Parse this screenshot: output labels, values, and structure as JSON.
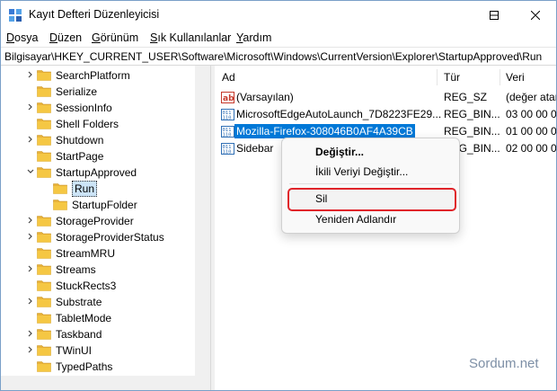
{
  "window": {
    "title": "Kayıt Defteri Düzenleyicisi",
    "controls": {
      "minimize": "minimize-icon",
      "maximize": "maximize-icon",
      "close": "close-icon"
    }
  },
  "menu": {
    "items": [
      {
        "u": "D",
        "rest": "osya"
      },
      {
        "u": "D",
        "rest": "üzen"
      },
      {
        "u": "G",
        "rest": "örünüm"
      },
      {
        "u": "S",
        "rest": "ık Kullanılanlar"
      },
      {
        "u": "Y",
        "rest": "ardım"
      }
    ]
  },
  "address": "Bilgisayar\\HKEY_CURRENT_USER\\Software\\Microsoft\\Windows\\CurrentVersion\\Explorer\\StartupApproved\\Run",
  "tree": {
    "items": [
      {
        "label": "SearchPlatform",
        "chevron": "right"
      },
      {
        "label": "Serialize",
        "chevron": "none"
      },
      {
        "label": "SessionInfo",
        "chevron": "right"
      },
      {
        "label": "Shell Folders",
        "chevron": "none"
      },
      {
        "label": "Shutdown",
        "chevron": "right"
      },
      {
        "label": "StartPage",
        "chevron": "none"
      },
      {
        "label": "StartupApproved",
        "chevron": "down"
      },
      {
        "label": "Run",
        "chevron": "none",
        "selected": true
      },
      {
        "label": "StartupFolder",
        "chevron": "none"
      },
      {
        "label": "StorageProvider",
        "chevron": "right"
      },
      {
        "label": "StorageProviderStatus",
        "chevron": "right"
      },
      {
        "label": "StreamMRU",
        "chevron": "none"
      },
      {
        "label": "Streams",
        "chevron": "right"
      },
      {
        "label": "StuckRects3",
        "chevron": "none"
      },
      {
        "label": "Substrate",
        "chevron": "right"
      },
      {
        "label": "TabletMode",
        "chevron": "none"
      },
      {
        "label": "Taskband",
        "chevron": "right"
      },
      {
        "label": "TWinUI",
        "chevron": "right"
      },
      {
        "label": "TypedPaths",
        "chevron": "none"
      }
    ]
  },
  "values": {
    "headers": {
      "name": "Ad",
      "type": "Tür",
      "data": "Veri"
    },
    "rows": [
      {
        "name": "(Varsayılan)",
        "type": "REG_SZ",
        "data": "(değer atan",
        "icon": "string-value-icon"
      },
      {
        "name": "MicrosoftEdgeAutoLaunch_7D8223FE29...",
        "type": "REG_BIN...",
        "data": "03 00 00 00",
        "icon": "binary-value-icon"
      },
      {
        "name": "Mozilla-Firefox-308046B0AF4A39CB",
        "type": "REG_BIN...",
        "data": "01 00 00 00",
        "icon": "binary-value-icon",
        "selected": true
      },
      {
        "name": "Sidebar",
        "type": "REG_BIN...",
        "data": "02 00 00 00",
        "icon": "binary-value-icon"
      }
    ]
  },
  "context_menu": {
    "modify": "Değiştir...",
    "modify_binary": "İkili Veriyi Değiştir...",
    "delete": "Sil",
    "rename": "Yeniden Adlandır"
  },
  "watermark": "Sordum.net",
  "colors": {
    "selection": "#0078d7",
    "tree_selection": "#cce4f7",
    "highlight_border": "#e0242a",
    "folder": "#f5c743"
  }
}
